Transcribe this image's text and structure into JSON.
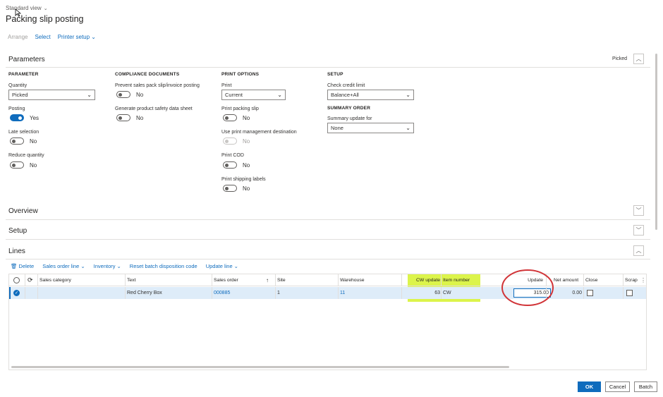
{
  "header": {
    "view_label": "Standard view",
    "page_title": "Packing slip posting"
  },
  "action_bar": {
    "arrange": "Arrange",
    "select": "Select",
    "printer_setup": "Printer setup"
  },
  "parameters": {
    "title": "Parameters",
    "summary": "Picked",
    "parameter": {
      "heading": "PARAMETER",
      "quantity_label": "Quantity",
      "quantity_value": "Picked",
      "posting_label": "Posting",
      "posting_value": "Yes",
      "late_selection_label": "Late selection",
      "late_selection_value": "No",
      "reduce_quantity_label": "Reduce quantity",
      "reduce_quantity_value": "No"
    },
    "compliance": {
      "heading": "COMPLIANCE DOCUMENTS",
      "prevent_label": "Prevent sales pack slip/invoice posting",
      "prevent_value": "No",
      "generate_label": "Generate product safety data sheet",
      "generate_value": "No"
    },
    "print_options": {
      "heading": "PRINT OPTIONS",
      "print_label": "Print",
      "print_value": "Current",
      "print_packing_slip_label": "Print packing slip",
      "print_packing_slip_value": "No",
      "use_print_mgmt_label": "Use print management destination",
      "use_print_mgmt_value": "No",
      "print_cod_label": "Print COD",
      "print_cod_value": "No",
      "print_shipping_labels_label": "Print shipping labels",
      "print_shipping_labels_value": "No"
    },
    "setup": {
      "heading": "SETUP",
      "check_credit_label": "Check credit limit",
      "check_credit_value": "Balance+All",
      "summary_order_heading": "SUMMARY ORDER",
      "summary_update_label": "Summary update for",
      "summary_update_value": "None"
    }
  },
  "sections": {
    "overview": "Overview",
    "setup": "Setup",
    "lines": "Lines"
  },
  "lines_toolbar": {
    "delete": "Delete",
    "sales_order_line": "Sales order line",
    "inventory": "Inventory",
    "reset_batch": "Reset batch disposition code",
    "update_line": "Update line"
  },
  "grid": {
    "columns": {
      "sales_category": "Sales category",
      "text": "Text",
      "sales_order": "Sales order",
      "site": "Site",
      "warehouse": "Warehouse",
      "cw_update": "CW update",
      "item_number": "Item number",
      "update": "Update",
      "net_amount": "Net amount",
      "close": "Close",
      "scrap": "Scrap"
    },
    "row": {
      "sales_category": "",
      "text": "Red Cherry Box",
      "sales_order": "000885",
      "site": "1",
      "warehouse": "11",
      "cw_update": "63",
      "item_number": "CW",
      "update": "315.00",
      "net_amount": "0.00"
    },
    "highlight_color": "#d6f22c",
    "annotation_color": "#d13438"
  },
  "footer": {
    "ok": "OK",
    "cancel": "Cancel",
    "batch": "Batch"
  }
}
